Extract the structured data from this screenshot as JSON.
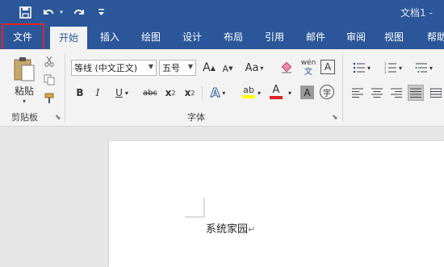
{
  "titlebar": {
    "doc_title": "文档1 - ",
    "icons": [
      "save-icon",
      "undo-icon",
      "redo-icon",
      "customize-qat-icon"
    ]
  },
  "tabs": [
    {
      "label": "文件",
      "highlighted": true
    },
    {
      "label": "开始",
      "active": true
    },
    {
      "label": "插入"
    },
    {
      "label": "绘图"
    },
    {
      "label": "设计"
    },
    {
      "label": "布局"
    },
    {
      "label": "引用"
    },
    {
      "label": "邮件"
    },
    {
      "label": "审阅"
    },
    {
      "label": "视图"
    },
    {
      "label": "帮助"
    }
  ],
  "clipboard": {
    "paste_label": "粘贴",
    "group_label": "剪贴板"
  },
  "font": {
    "font_name": "等线 (中文正文)",
    "font_size": "五号",
    "grow_label": "A",
    "shrink_label": "A",
    "case_label": "Aa",
    "pinyin_top": "wén",
    "pinyin_bottom": "文",
    "border_char": "A",
    "bold": "B",
    "italic": "I",
    "underline": "U",
    "strike": "abc",
    "subscript": "x",
    "subscript_mark": "2",
    "superscript": "x",
    "superscript_mark": "2",
    "effects": "A",
    "highlight": "ab",
    "font_color": "A",
    "shading": "A",
    "enclose": "字",
    "group_label": "字体",
    "colors": {
      "highlight": "#ffff00",
      "font_color": "#e32222"
    }
  },
  "document": {
    "text": "系统家园",
    "para_mark": "↵"
  },
  "colors": {
    "accent": "#2b579a",
    "file_highlight": "#e32222"
  }
}
